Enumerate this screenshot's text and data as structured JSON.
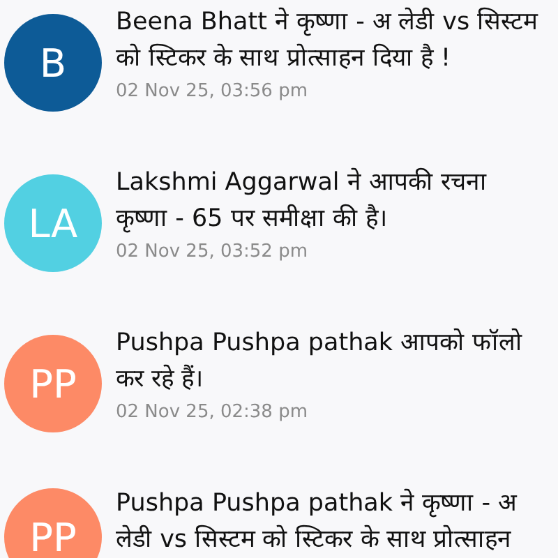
{
  "notifications": [
    {
      "initials": "B",
      "color": "#0d5b97",
      "message": "Beena Bhatt ने कृष्णा - अ लेडी vs सिस्टम को स्टिकर के साथ प्रोत्साहन दिया है !",
      "time": "02 Nov 25, 03:56 pm"
    },
    {
      "initials": "LA",
      "color": "#52d0e2",
      "message": "Lakshmi Aggarwal ने आपकी रचना कृष्णा - 65 पर समीक्षा की है।",
      "time": "02 Nov 25, 03:52 pm"
    },
    {
      "initials": "PP",
      "color": "#fd8a66",
      "message": "Pushpa Pushpa pathak आपको फॉलो कर रहे हैं।",
      "time": "02 Nov 25, 02:38 pm"
    },
    {
      "initials": "PP",
      "color": "#fd8a66",
      "message": "Pushpa Pushpa pathak ने कृष्णा - अ लेडी vs सिस्टम को स्टिकर के साथ प्रोत्साहन"
    }
  ]
}
